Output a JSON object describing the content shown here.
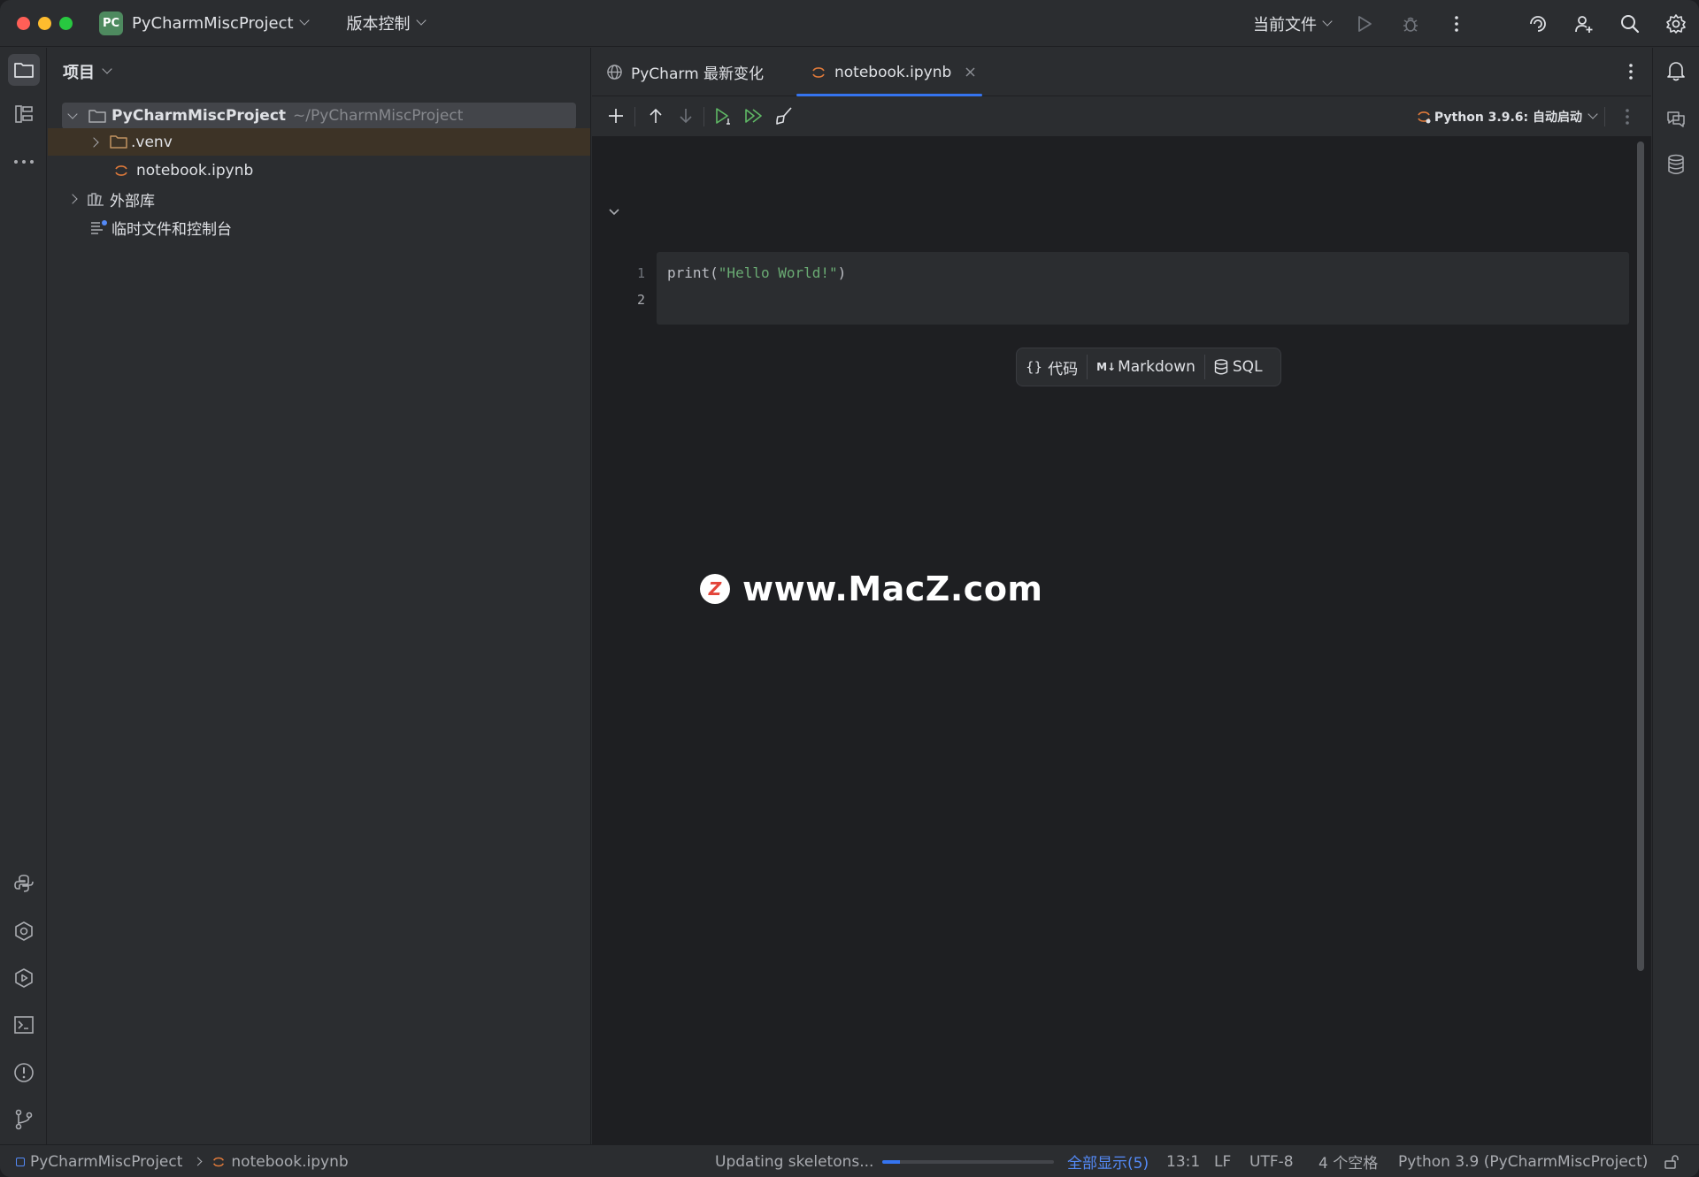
{
  "titlebar": {
    "project_badge": "PC",
    "project_name": "PyCharmMiscProject",
    "vcs_label": "版本控制",
    "current_file_label": "当前文件"
  },
  "project_panel": {
    "title": "项目",
    "root": {
      "name": "PyCharmMiscProject",
      "path": "~/PyCharmMiscProject"
    },
    "items": [
      {
        "label": ".venv"
      },
      {
        "label": "notebook.ipynb"
      },
      {
        "label": "外部库"
      },
      {
        "label": "临时文件和控制台"
      }
    ]
  },
  "editor": {
    "tabs": [
      {
        "label": "PyCharm 最新变化"
      },
      {
        "label": "notebook.ipynb"
      }
    ],
    "kernel_label": "Python 3.9.6: 自动启动",
    "cell": {
      "line_numbers": [
        "1",
        "2"
      ],
      "code_prefix": "print(",
      "code_string": "\"Hello World!\"",
      "code_suffix": ")"
    },
    "add_cell": {
      "code_label": "代码",
      "markdown_label": "Markdown",
      "sql_label": "SQL"
    },
    "watermark": {
      "badge": "Z",
      "text": "www.MacZ.com"
    }
  },
  "statusbar": {
    "breadcrumb_project": "PyCharmMiscProject",
    "breadcrumb_file": "notebook.ipynb",
    "progress_label": "Updating skeletons...",
    "progress_fraction": 0.1,
    "show_all": "全部显示(5)",
    "cursor_pos": "13:1",
    "line_sep": "LF",
    "encoding": "UTF-8",
    "indent": "4 个空格",
    "interpreter": "Python 3.9 (PyCharmMiscProject)"
  },
  "colors": {
    "accent": "#3574f0",
    "background": "#1e1f22",
    "panel": "#2b2d30",
    "string": "#6aab73",
    "jupyter_orange": "#e07a3a"
  }
}
